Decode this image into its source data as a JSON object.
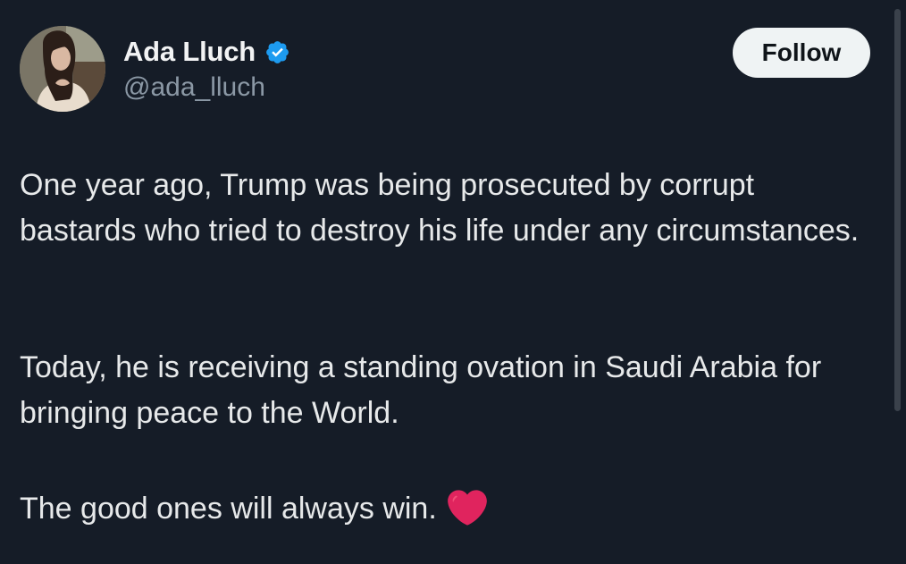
{
  "author": {
    "display_name": "Ada Lluch",
    "handle": "@ada_lluch",
    "verified": true
  },
  "actions": {
    "follow_label": "Follow"
  },
  "tweet": {
    "paragraphs": [
      "One year ago, Trump was being prosecuted by corrupt bastards who tried to destroy his life under any circumstances.",
      "Today, he is receiving a standing ovation in Saudi Arabia for bringing peace to the World.",
      "The good ones will always win."
    ],
    "emoji": "red-heart"
  },
  "colors": {
    "background": "#151c27",
    "text": "#e7e9ea",
    "secondary_text": "#8b98a5",
    "verified_badge": "#1d9bf0",
    "follow_button_bg": "#eff3f4",
    "heart": "#e0245e"
  },
  "icons": [
    "verified-badge-icon",
    "heart-icon"
  ]
}
